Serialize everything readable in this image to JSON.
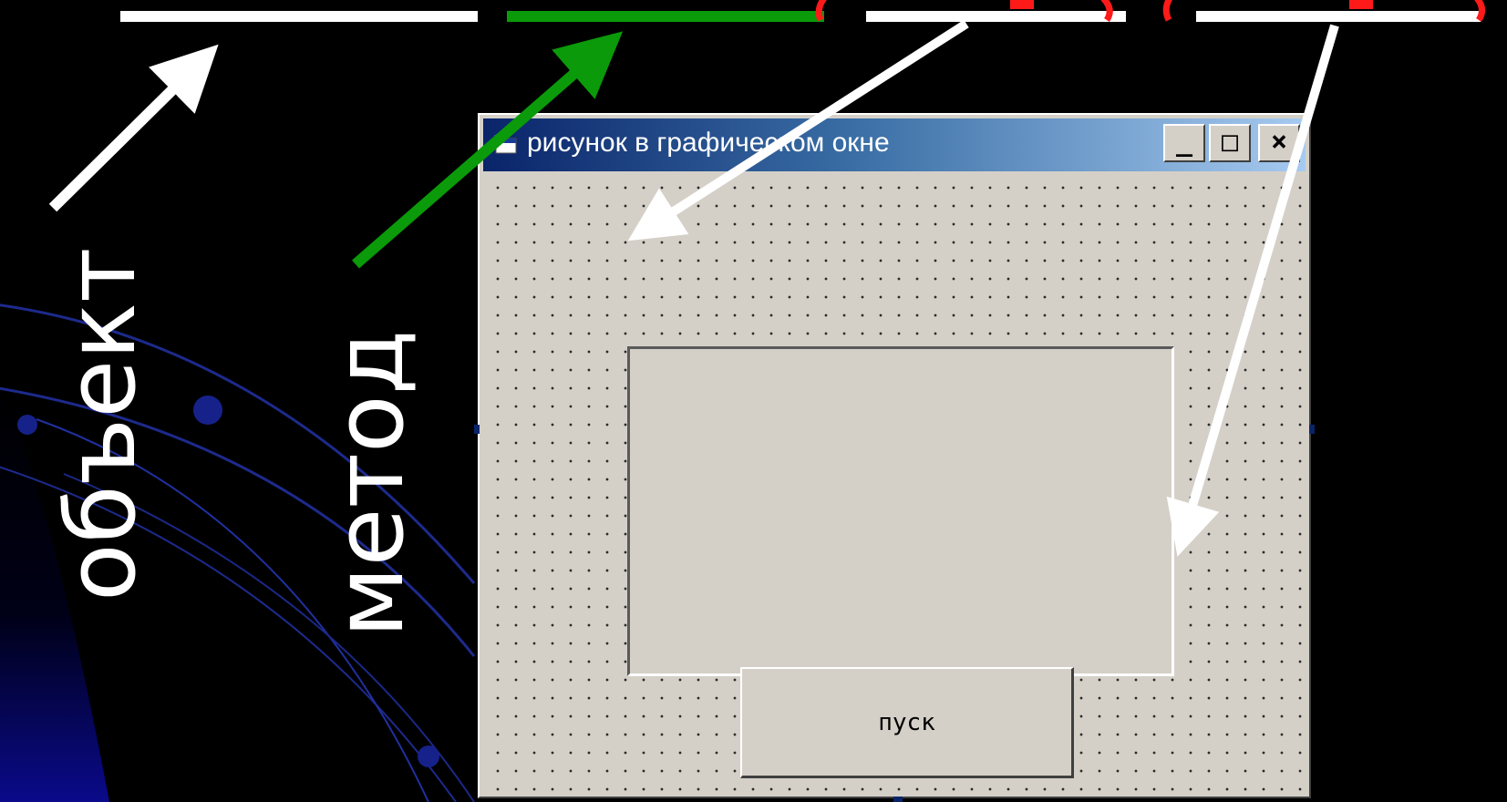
{
  "labels": {
    "object": "объект",
    "method": "метод"
  },
  "window": {
    "title": "рисунок в графическом окне",
    "minimize": "_",
    "maximize": "□",
    "close": "×"
  },
  "form": {
    "button_label": "пуск"
  },
  "colors": {
    "background": "#000000",
    "green_blank": "#0a9a0a",
    "red_partial": "#ff1a1a",
    "form_face": "#d4d0c8",
    "titlebar_start": "#0a246a",
    "titlebar_end": "#a6caf0"
  }
}
